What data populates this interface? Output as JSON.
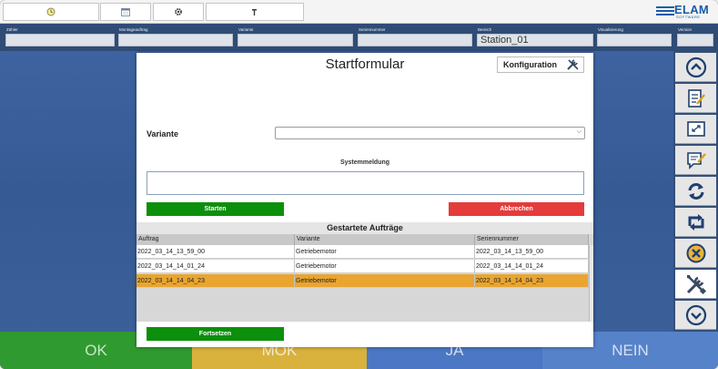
{
  "toolbar": {
    "buttons": [
      "clock-icon",
      "calendar-icon",
      "gear-icon",
      "tool-icon"
    ]
  },
  "logo": {
    "name": "ELAM",
    "sub": "SOFTWARE"
  },
  "infobar": {
    "zaehler": {
      "label": "Zähler",
      "value": ""
    },
    "montageauftrag": {
      "label": "Montageauftrag",
      "value": ""
    },
    "variante": {
      "label": "Variante",
      "value": ""
    },
    "seriennummer": {
      "label": "Seriennummer",
      "value": ""
    },
    "bereich": {
      "label": "Bereich",
      "value": "Station_01"
    },
    "visualisierung": {
      "label": "Visualisierung",
      "value": ""
    },
    "version": {
      "label": "Version",
      "value": ""
    }
  },
  "modal": {
    "title": "Startformular",
    "konfiguration_label": "Konfiguration",
    "variante_label": "Variante",
    "variante_value": "",
    "systemmeldung_label": "Systemmeldung",
    "systemmeldung_value": "",
    "start_label": "Starten",
    "cancel_label": "Abbrechen",
    "continue_label": "Fortsetzen",
    "table": {
      "title": "Gestartete Aufträge",
      "columns": [
        "Auftrag",
        "Variante",
        "Seriennummer"
      ],
      "rows": [
        [
          "2022_03_14_13_59_00",
          "Getriebemotor",
          "2022_03_14_13_59_00"
        ],
        [
          "2022_03_14_14_01_24",
          "Getriebemotor",
          "2022_03_14_14_01_24"
        ],
        [
          "2022_03_14_14_04_23",
          "Getriebemotor",
          "2022_03_14_14_04_23"
        ]
      ],
      "selected_row": 2
    }
  },
  "sidebar": {
    "items": [
      "scroll-up-icon",
      "checklist-icon",
      "screen-icon",
      "edit-note-icon",
      "refresh-icon",
      "repeat-icon",
      "cancel-circle-icon",
      "tools-icon",
      "scroll-down-icon"
    ],
    "active_index": 7
  },
  "bottom": {
    "ok": "OK",
    "mok": "MOK",
    "ja": "JA",
    "nein": "NEIN"
  },
  "colors": {
    "ok": "#2f9a2f",
    "mok": "#d8b23c",
    "ja": "#4c77c4",
    "nein": "#5682c9",
    "selected_row": "#e9a530",
    "start": "#0c8f0c",
    "cancel": "#e63b3b"
  }
}
